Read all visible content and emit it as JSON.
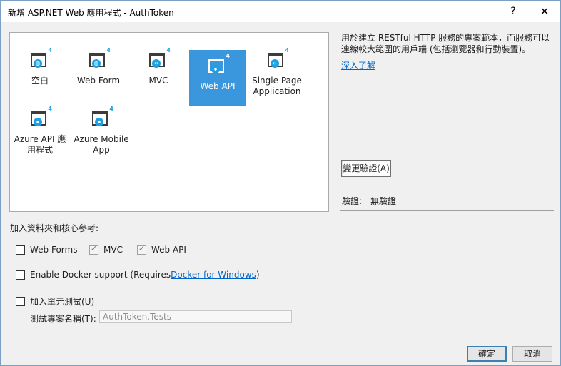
{
  "window": {
    "title": "新增 ASP.NET Web 應用程式 - AuthToken",
    "help": "?",
    "close": "✕"
  },
  "templates": [
    {
      "label": "空白",
      "glyph": "◍",
      "selected": false
    },
    {
      "label": "Web Form",
      "glyph": "◍",
      "selected": false
    },
    {
      "label": "MVC",
      "glyph": "‹›",
      "selected": false
    },
    {
      "label": "Web API",
      "glyph": "⦁",
      "selected": true
    },
    {
      "label": "Single Page Application",
      "glyph": "‹›",
      "selected": false
    },
    {
      "label": "Azure API 應用程式",
      "glyph": "⦁",
      "selected": false
    },
    {
      "label": "Azure Mobile App",
      "glyph": "⦁",
      "selected": false
    }
  ],
  "template_badge": "4",
  "description": "用於建立 RESTful HTTP 服務的專案範本，而服務可以連線較大範圍的用戶端 (包括瀏覽器和行動裝置)。",
  "learn_more": "深入了解",
  "change_auth": "變更驗證(A)",
  "auth": {
    "label": "驗證:",
    "value": "無驗證"
  },
  "core_refs": {
    "label": "加入資料夾和核心參考:",
    "web_forms": {
      "label": "Web Forms",
      "checked": false
    },
    "mvc": {
      "label": "MVC",
      "checked": true
    },
    "web_api": {
      "label": "Web API",
      "checked": true
    }
  },
  "docker": {
    "label_prefix": "Enable Docker support (Requires ",
    "link": "Docker for Windows",
    "label_suffix": ")",
    "checked": false
  },
  "unit_test": {
    "label": "加入單元測試(U)",
    "checked": false,
    "name_label": "測試專案名稱(T):",
    "name_value": "AuthToken.Tests"
  },
  "buttons": {
    "ok": "確定",
    "cancel": "取消"
  }
}
